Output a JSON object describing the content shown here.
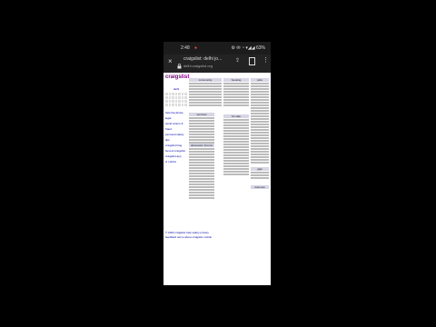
{
  "status_bar": {
    "time": "2:48",
    "recording_icon": "record-icon",
    "system_text": "⚙ ✉ ◔ ▾◢◢ 63%"
  },
  "browser": {
    "close_icon": "×",
    "page_title": "craigslist: delhi jo...",
    "url": "delhi.craigslist.org",
    "share_icon": "share-icon",
    "bookmark_icon": "bookmark-icon",
    "more_icon": "⋮"
  },
  "page": {
    "logo": "craigslist",
    "left_col": {
      "title": "delhi",
      "links": [
        "help faq abuse legal",
        "avoid scams & fraud",
        "personal safety tips",
        "craigslist blog",
        "best-of-craigslist",
        "craigslist app",
        "cl t-shirts"
      ]
    },
    "sections": [
      {
        "title": "community"
      },
      {
        "title": "housing"
      },
      {
        "title": "jobs"
      },
      {
        "title": "services"
      },
      {
        "title": "for sale"
      },
      {
        "title": "discussion forums"
      },
      {
        "title": "gigs"
      },
      {
        "title": "resumes"
      }
    ],
    "bottom_text": [
      "© 2023 craigslist help safety privacy",
      "feedback terms about craigslist mobile"
    ]
  }
}
